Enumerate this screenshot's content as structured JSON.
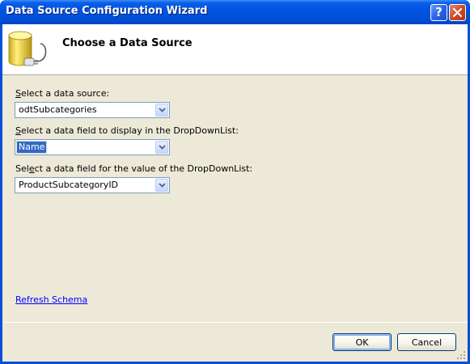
{
  "window": {
    "title": "Data Source Configuration Wizard"
  },
  "titlebar": {
    "help_glyph": "?",
    "help_icon": "help-icon",
    "close_icon": "close-icon"
  },
  "header": {
    "title": "Choose a Data Source",
    "icon": "database-plug-icon"
  },
  "fields": {
    "data_source": {
      "label_prefix": "",
      "label_accel": "S",
      "label_rest": "elect a data source:",
      "value": "odtSubcategories"
    },
    "display_field": {
      "label_prefix": "",
      "label_accel": "S",
      "label_rest": "elect a data field to display in the DropDownList:",
      "value": "Name"
    },
    "value_field": {
      "label_prefix": "Sel",
      "label_accel": "e",
      "label_rest": "ct a data field for the value of the DropDownList:",
      "value": "ProductSubcategoryID"
    }
  },
  "links": {
    "refresh_schema": "Refresh Schema"
  },
  "buttons": {
    "ok": "OK",
    "cancel": "Cancel"
  },
  "colors": {
    "titlebar": "#0054e3",
    "dialog_bg": "#ece9d8",
    "selection": "#316ac5",
    "link": "#0000ff"
  }
}
